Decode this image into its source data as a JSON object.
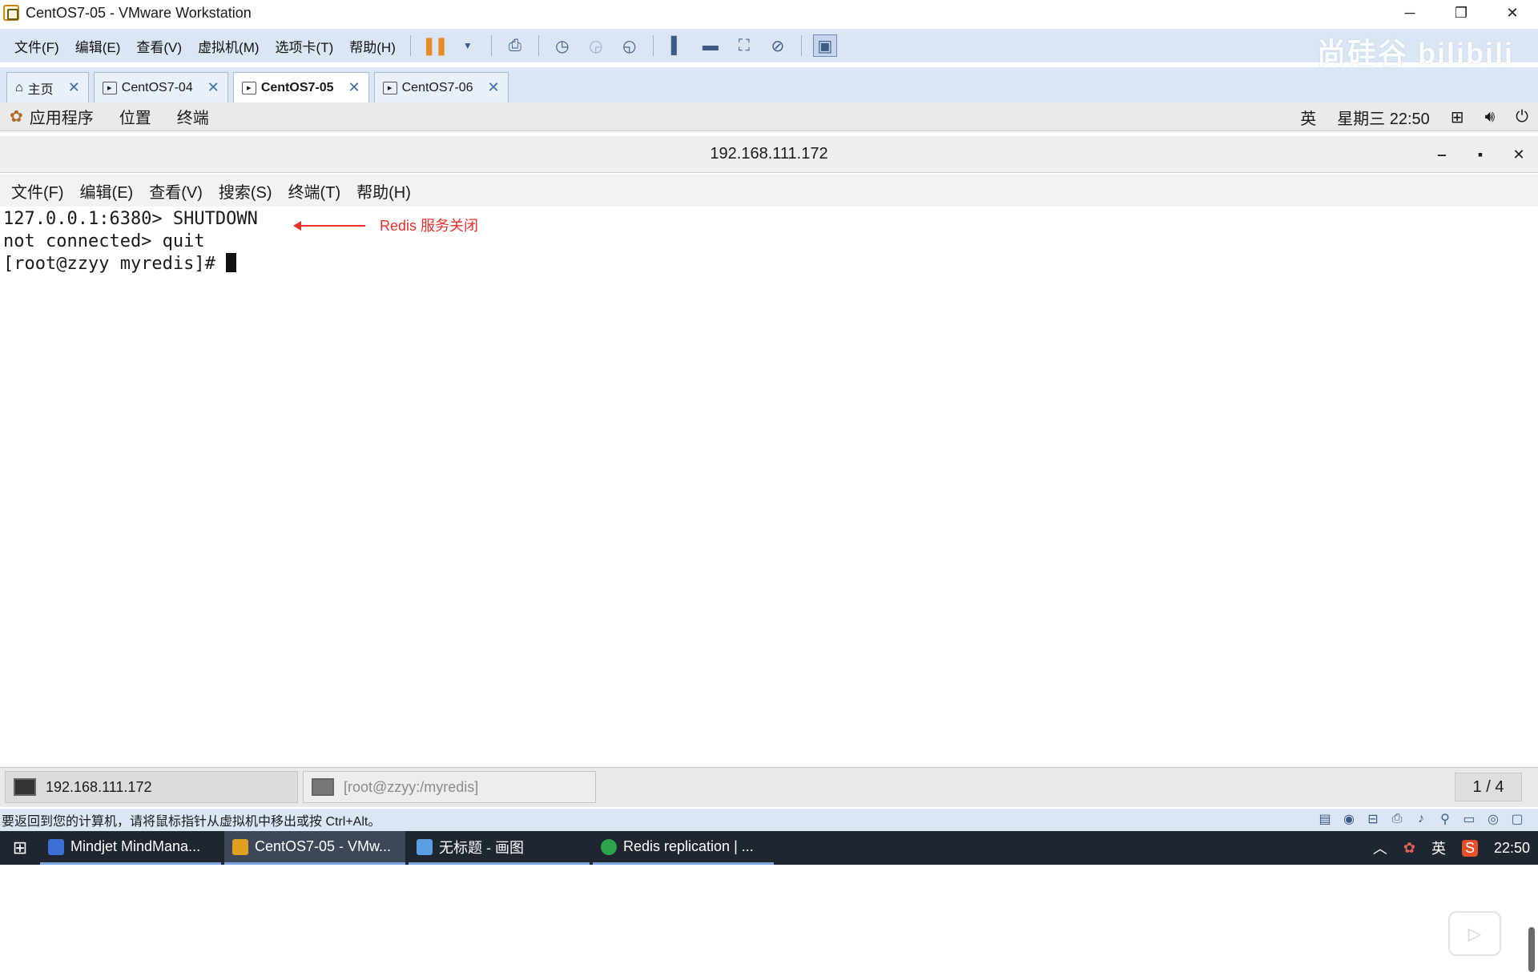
{
  "window": {
    "title": "CentOS7-05 - VMware Workstation",
    "minimize": "─",
    "restore": "❐",
    "close": "✕"
  },
  "vmware_menu": [
    "文件(F)",
    "编辑(E)",
    "查看(V)",
    "虚拟机(M)",
    "选项卡(T)",
    "帮助(H)"
  ],
  "watermark": "尚硅谷 bilibili",
  "tabs": [
    {
      "label": "主页",
      "active": false
    },
    {
      "label": "CentOS7-04",
      "active": false
    },
    {
      "label": "CentOS7-05",
      "active": true
    },
    {
      "label": "CentOS7-06",
      "active": false
    }
  ],
  "gnome": {
    "menu": [
      "应用程序",
      "位置",
      "终端"
    ],
    "input_method": "英",
    "clock": "星期三 22:50"
  },
  "terminal": {
    "title": "192.168.111.172",
    "menu": [
      "文件(F)",
      "编辑(E)",
      "查看(V)",
      "搜索(S)",
      "终端(T)",
      "帮助(H)"
    ],
    "lines": [
      "127.0.0.1:6380> SHUTDOWN",
      "not connected> quit",
      "[root@zzyy myredis]# "
    ],
    "annotation": "Redis 服务关闭",
    "tasks": [
      "192.168.111.172",
      "[root@zzyy:/myredis]"
    ],
    "page_indicator": "1 / 4"
  },
  "statusbar": {
    "message": "要返回到您的计算机，请将鼠标指针从虚拟机中移出或按 Ctrl+Alt。"
  },
  "taskbar": {
    "items": [
      {
        "label": "Mindjet MindMana...",
        "icon_color": "#3b6fd4"
      },
      {
        "label": "CentOS7-05 - VMw...",
        "icon_color": "#e0a020"
      },
      {
        "label": "无标题 - 画图",
        "icon_color": "#5aa0e0"
      },
      {
        "label": "Redis replication | ...",
        "icon_color": "#2ea44f"
      }
    ],
    "tray_ime": "英",
    "time": "22:50"
  }
}
